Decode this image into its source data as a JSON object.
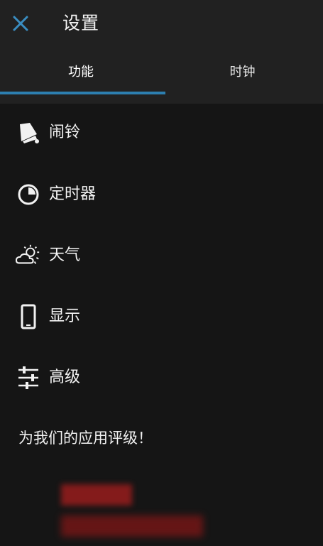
{
  "header": {
    "title": "设置",
    "close_icon": "close-icon",
    "accent_color": "#2d7fb0"
  },
  "tabs": [
    {
      "label": "功能",
      "selected": true
    },
    {
      "label": "时钟",
      "selected": false
    }
  ],
  "menu": [
    {
      "label": "闹铃",
      "icon": "bell-icon"
    },
    {
      "label": "定时器",
      "icon": "timer-icon"
    },
    {
      "label": "天气",
      "icon": "weather-icon"
    },
    {
      "label": "显示",
      "icon": "phone-icon"
    },
    {
      "label": "高级",
      "icon": "sliders-icon"
    }
  ],
  "rate_link": "为我们的应用评级！",
  "redacted_color": "#8a1c1c"
}
